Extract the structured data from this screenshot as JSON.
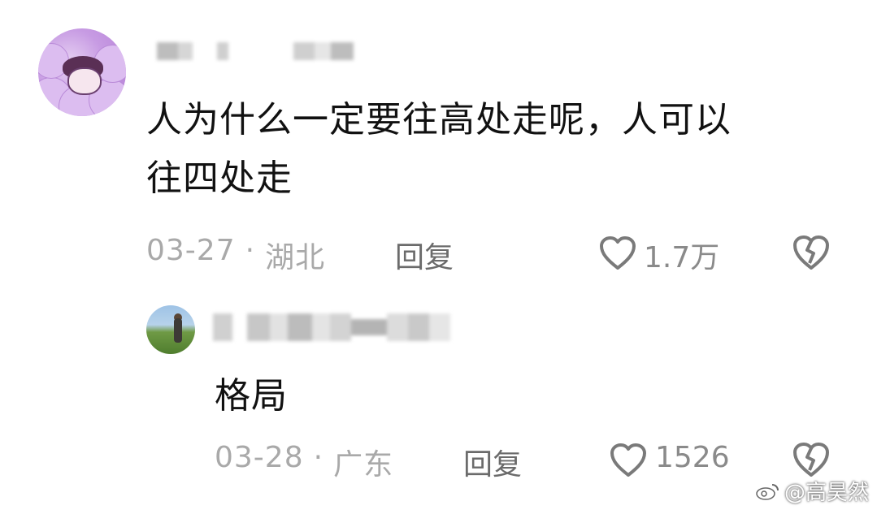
{
  "comments": [
    {
      "text_line1": "人为什么一定要往高处走呢，人可以",
      "text_line2": "往四处走",
      "date": "03-27",
      "location": "湖北",
      "separator": "·",
      "reply_label": "回复",
      "likes": "1.7万"
    },
    {
      "text_line1": "格局",
      "date": "03-28",
      "location": "广东",
      "separator": "·",
      "reply_label": "回复",
      "likes": "1526"
    }
  ],
  "watermark": {
    "handle": "@高昊然"
  },
  "colors": {
    "meta": "#a9a9a9",
    "text": "#111111",
    "icon": "#7a7a7a"
  },
  "icons": [
    "heart-icon",
    "broken-heart-icon",
    "weibo-icon"
  ]
}
